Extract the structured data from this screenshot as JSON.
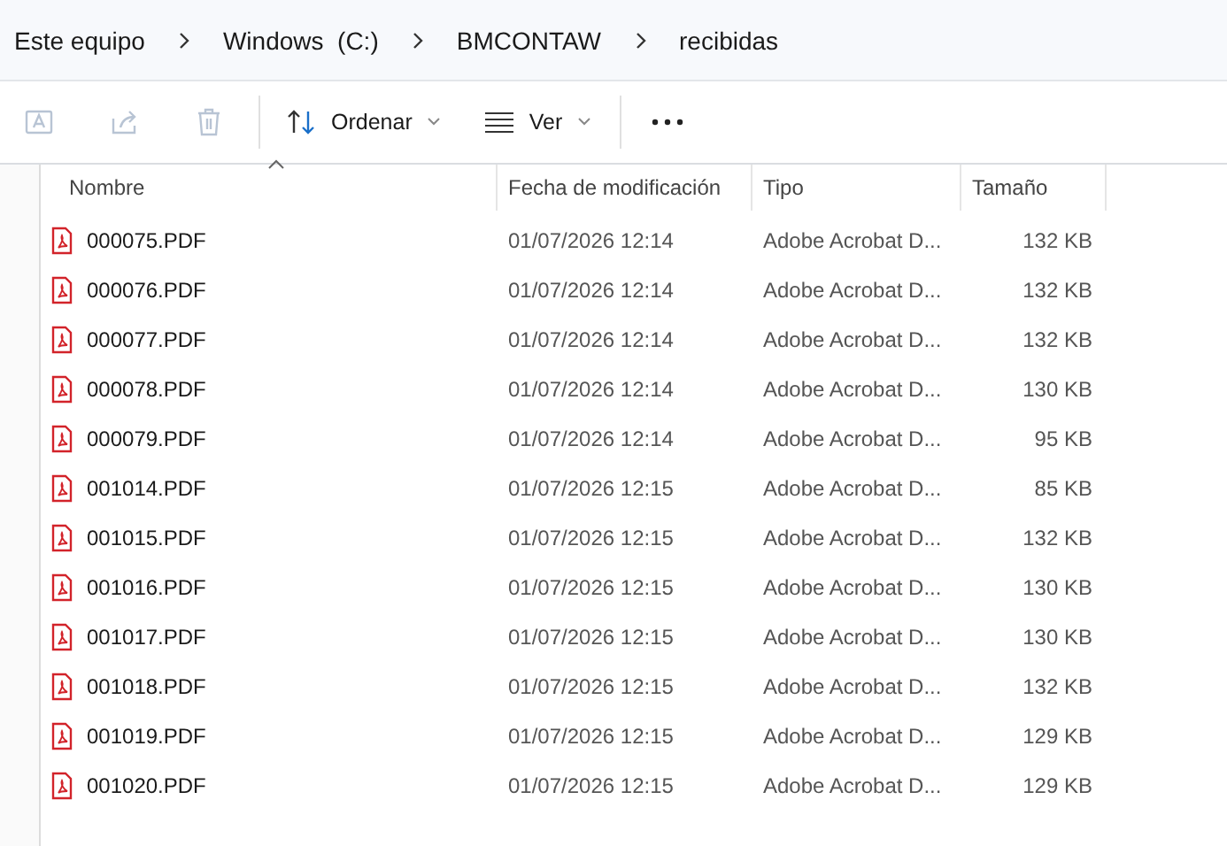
{
  "breadcrumb": [
    "Este equipo",
    "Windows  (C:)",
    "BMCONTAW",
    "recibidas"
  ],
  "toolbar": {
    "sort_label": "Ordenar",
    "view_label": "Ver"
  },
  "table": {
    "columns": [
      "Nombre",
      "Fecha de modificación",
      "Tipo",
      "Tamaño"
    ],
    "rows": [
      {
        "name": "000075.PDF",
        "date": "01/07/2026 12:14",
        "type": "Adobe Acrobat D...",
        "size": "132 KB"
      },
      {
        "name": "000076.PDF",
        "date": "01/07/2026 12:14",
        "type": "Adobe Acrobat D...",
        "size": "132 KB"
      },
      {
        "name": "000077.PDF",
        "date": "01/07/2026 12:14",
        "type": "Adobe Acrobat D...",
        "size": "132 KB"
      },
      {
        "name": "000078.PDF",
        "date": "01/07/2026 12:14",
        "type": "Adobe Acrobat D...",
        "size": "130 KB"
      },
      {
        "name": "000079.PDF",
        "date": "01/07/2026 12:14",
        "type": "Adobe Acrobat D...",
        "size": "95 KB"
      },
      {
        "name": "001014.PDF",
        "date": "01/07/2026 12:15",
        "type": "Adobe Acrobat D...",
        "size": "85 KB"
      },
      {
        "name": "001015.PDF",
        "date": "01/07/2026 12:15",
        "type": "Adobe Acrobat D...",
        "size": "132 KB"
      },
      {
        "name": "001016.PDF",
        "date": "01/07/2026 12:15",
        "type": "Adobe Acrobat D...",
        "size": "130 KB"
      },
      {
        "name": "001017.PDF",
        "date": "01/07/2026 12:15",
        "type": "Adobe Acrobat D...",
        "size": "130 KB"
      },
      {
        "name": "001018.PDF",
        "date": "01/07/2026 12:15",
        "type": "Adobe Acrobat D...",
        "size": "132 KB"
      },
      {
        "name": "001019.PDF",
        "date": "01/07/2026 12:15",
        "type": "Adobe Acrobat D...",
        "size": "129 KB"
      },
      {
        "name": "001020.PDF",
        "date": "01/07/2026 12:15",
        "type": "Adobe Acrobat D...",
        "size": "129 KB"
      }
    ]
  }
}
